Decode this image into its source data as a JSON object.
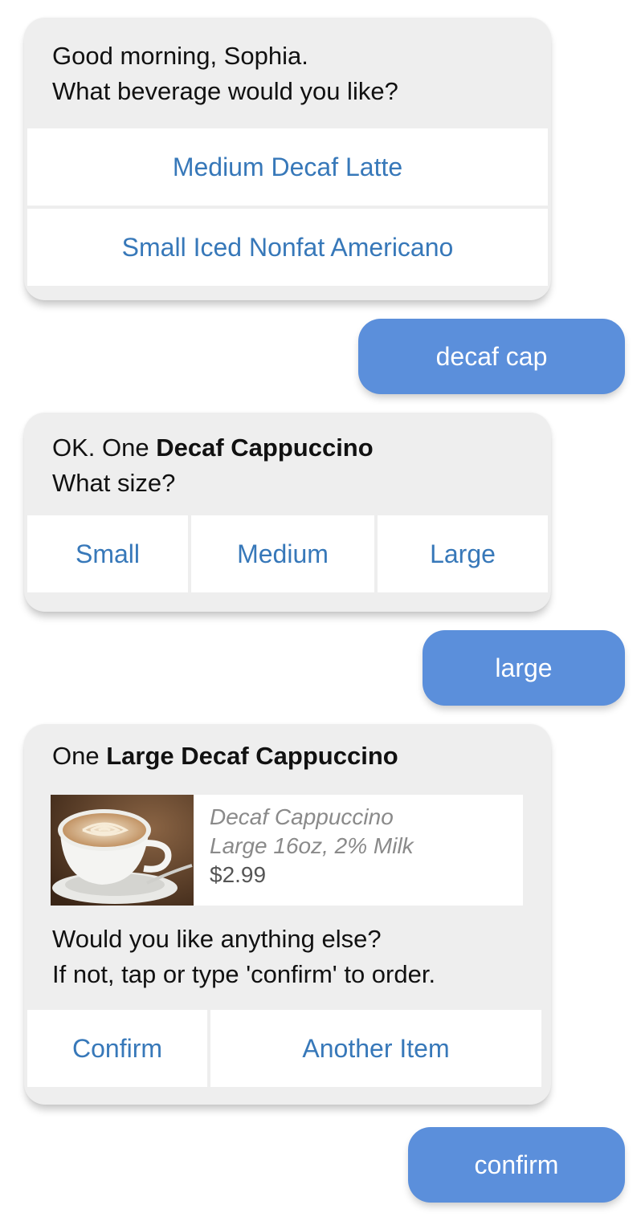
{
  "card1": {
    "line1": "Good morning, Sophia.",
    "line2": "What beverage would you like?",
    "options": [
      "Medium Decaf Latte",
      "Small Iced Nonfat Americano"
    ]
  },
  "user1": "decaf cap",
  "card2": {
    "line1_prefix": "OK. One ",
    "line1_bold": "Decaf Cappuccino",
    "line2": "What size?",
    "options": [
      "Small",
      "Medium",
      "Large"
    ]
  },
  "user2": "large",
  "card3": {
    "heading_prefix": "One ",
    "heading_bold": "Large Decaf Cappuccino",
    "product": {
      "name": "Decaf Cappuccino",
      "desc": "Large 16oz, 2% Milk",
      "price": "$2.99",
      "image_icon": "cappuccino-photo"
    },
    "line1": "Would you like anything else?",
    "line2": "If not, tap or type 'confirm' to order.",
    "options": [
      "Confirm",
      "Another Item"
    ]
  },
  "user3": "confirm",
  "colors": {
    "link": "#3778b9",
    "user_bubble": "#5b8fdb",
    "card_bg": "#eeeeee"
  }
}
